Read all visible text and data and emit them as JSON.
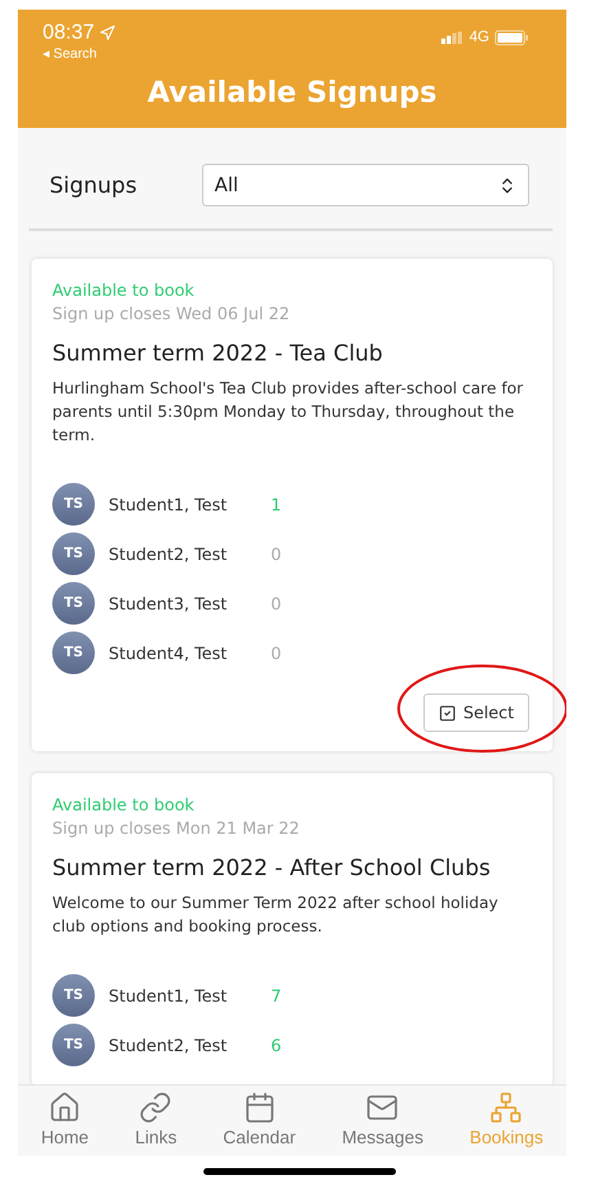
{
  "status_bar": {
    "time": "08:37",
    "back": "◂ Search",
    "network": "4G"
  },
  "header": {
    "title": "Available Signups"
  },
  "filter": {
    "label": "Signups",
    "value": "All"
  },
  "cards": [
    {
      "availability": "Available to book",
      "closes": "Sign up closes Wed 06 Jul 22",
      "title": "Summer term 2022 - Tea Club",
      "description": "Hurlingham School's Tea Club provides after-school care for parents until 5:30pm Monday to Thursday, throughout the term.",
      "students": [
        {
          "initials": "TS",
          "name": "Student1, Test",
          "count": "1",
          "color": "#2ecc71"
        },
        {
          "initials": "TS",
          "name": "Student2, Test",
          "count": "0",
          "color": "#aaaaaa"
        },
        {
          "initials": "TS",
          "name": "Student3, Test",
          "count": "0",
          "color": "#aaaaaa"
        },
        {
          "initials": "TS",
          "name": "Student4, Test",
          "count": "0",
          "color": "#aaaaaa"
        }
      ],
      "button": "Select",
      "circled": true
    },
    {
      "availability": "Available to book",
      "closes": "Sign up closes Mon 21 Mar 22",
      "title": "Summer term 2022 - After School Clubs",
      "description": "Welcome to our Summer Term 2022 after school holiday club options and booking process.",
      "students": [
        {
          "initials": "TS",
          "name": "Student1, Test",
          "count": "7",
          "color": "#2ecc71"
        },
        {
          "initials": "TS",
          "name": "Student2, Test",
          "count": "6",
          "color": "#2ecc71"
        }
      ]
    }
  ],
  "tabs": [
    {
      "label": "Home",
      "selected": false
    },
    {
      "label": "Links",
      "selected": false
    },
    {
      "label": "Calendar",
      "selected": false
    },
    {
      "label": "Messages",
      "selected": false
    },
    {
      "label": "Bookings",
      "selected": true
    }
  ]
}
